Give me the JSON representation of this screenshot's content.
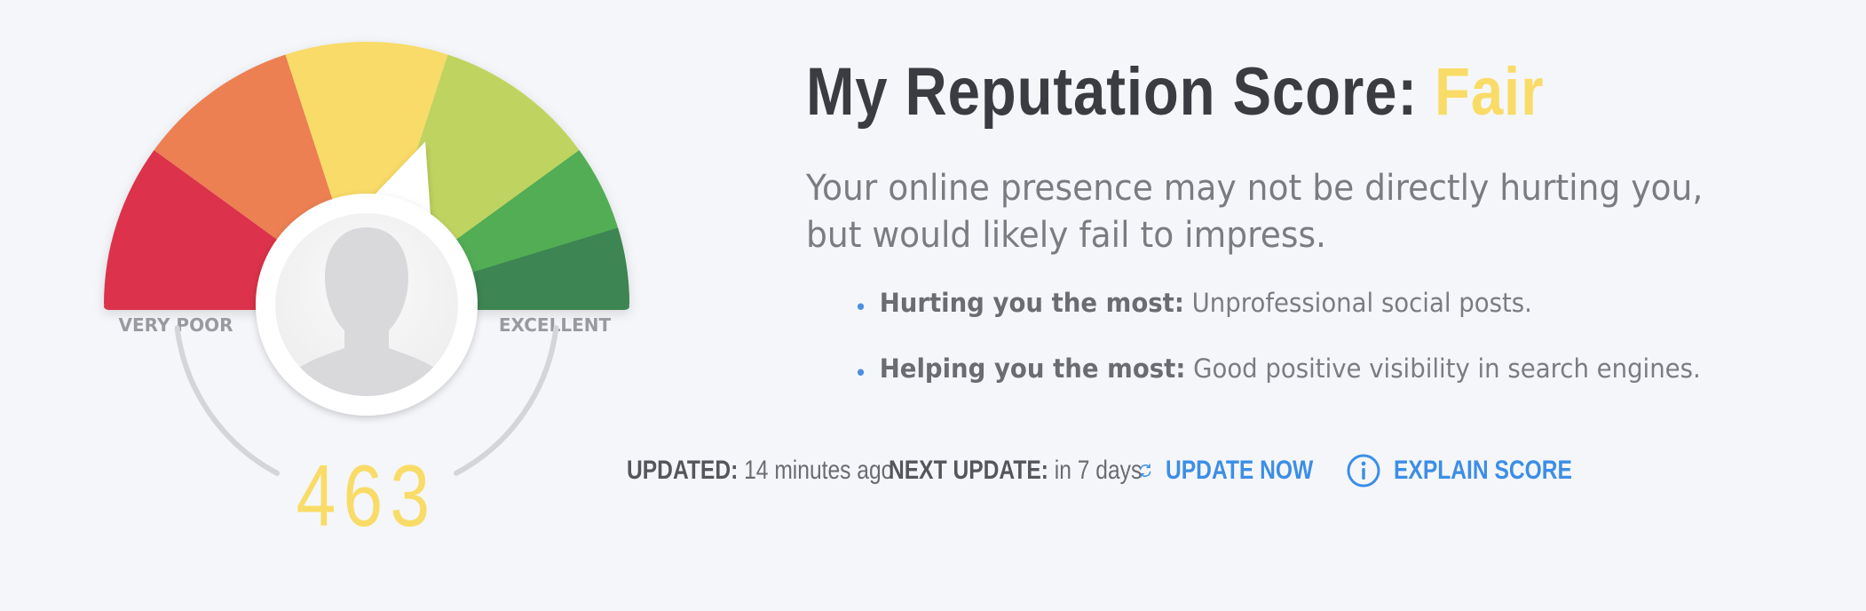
{
  "gauge": {
    "segment_colors": [
      "#dc334b",
      "#ec8053",
      "#f8db67",
      "#bfd460",
      "#53ad55",
      "#3c8553"
    ],
    "label_min": "VERY POOR",
    "label_max": "EXCELLENT",
    "score": "463",
    "score_value": 463,
    "needle_fraction": 0.61,
    "score_color": "#f9dc67"
  },
  "heading": {
    "prefix": "My Reputation Score:",
    "rating": "Fair",
    "rating_color": "#f9dc67"
  },
  "description": "Your online presence may not be directly hurting you, but would likely fail to impress.",
  "bullets": [
    {
      "label": "Hurting you the most:",
      "text": "Unprofessional social posts."
    },
    {
      "label": "Helping you the most:",
      "text": "Good positive visibility in search engines."
    }
  ],
  "status": {
    "updated_label": "UPDATED:",
    "updated_value": "14 minutes ago",
    "next_label": "NEXT UPDATE:",
    "next_value": "in 7 days"
  },
  "actions": {
    "update_now": "UPDATE NOW",
    "explain_score": "EXPLAIN SCORE",
    "update_icon": "refresh-icon",
    "explain_icon": "info-icon"
  },
  "colors": {
    "accent": "#3c8ee6",
    "bullet": "#4a90e2",
    "text": "#7b7c82",
    "heading": "#3b3c41"
  }
}
